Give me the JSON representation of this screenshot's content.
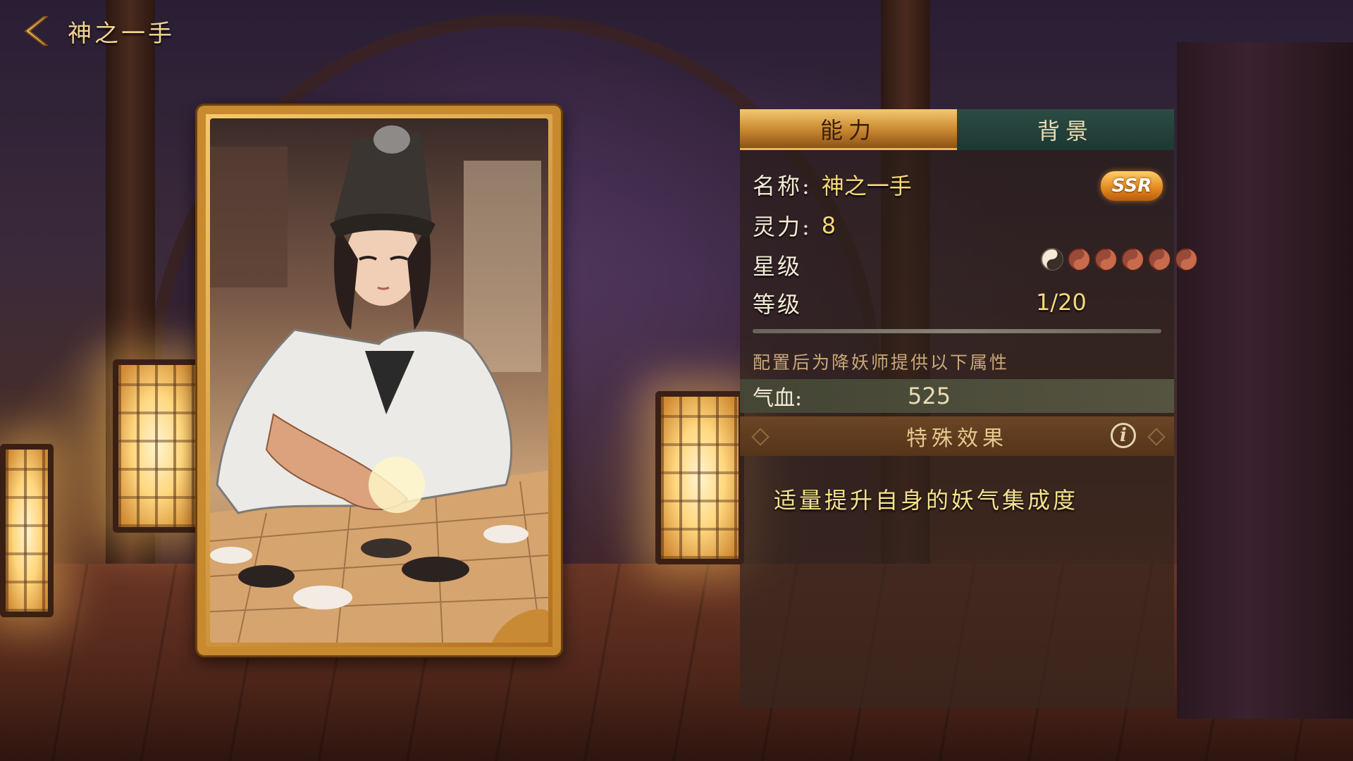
{
  "header": {
    "back_icon": "chevron-left-icon",
    "title": "神之一手"
  },
  "tabs": [
    {
      "label": "能力",
      "active": true
    },
    {
      "label": "背景",
      "active": false
    }
  ],
  "info": {
    "name_label": "名称:",
    "name_value": "神之一手",
    "rarity": "SSR",
    "power_label": "灵力:",
    "power_value": "8",
    "star_label": "星级",
    "stars_filled": 1,
    "stars_total": 6,
    "level_label": "等级",
    "level_value": "1/20"
  },
  "attributes": {
    "note": "配置后为降妖师提供以下属性",
    "hp_label": "气血:",
    "hp_value": "525"
  },
  "special": {
    "title": "特殊效果",
    "info_icon": "info-icon",
    "effect": "适量提升自身的妖气集成度"
  },
  "colors": {
    "accent_gold": "#f6d87a",
    "tab_active": "#c8862f",
    "tab_inactive": "#1d3832",
    "card_border": "#c78a2e"
  }
}
